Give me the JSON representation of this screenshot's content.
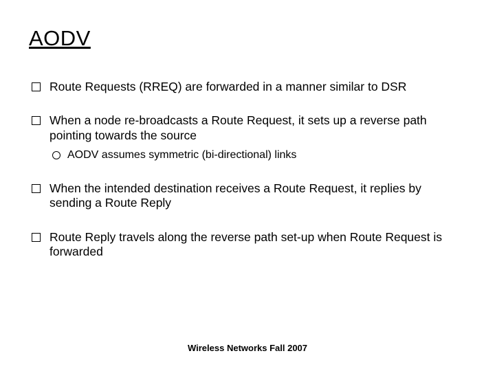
{
  "title": "AODV",
  "bullets": [
    {
      "text": "Route Requests (RREQ) are forwarded in a manner similar to DSR"
    },
    {
      "text": "When a node re-broadcasts a Route Request, it sets up a reverse path pointing towards the source",
      "sub": [
        "AODV assumes symmetric (bi-directional) links"
      ]
    },
    {
      "text": "When the intended destination receives a Route Request, it replies by sending a Route Reply"
    },
    {
      "text": "Route Reply travels along the reverse path set-up when Route Request is forwarded"
    }
  ],
  "footer": "Wireless Networks Fall 2007"
}
